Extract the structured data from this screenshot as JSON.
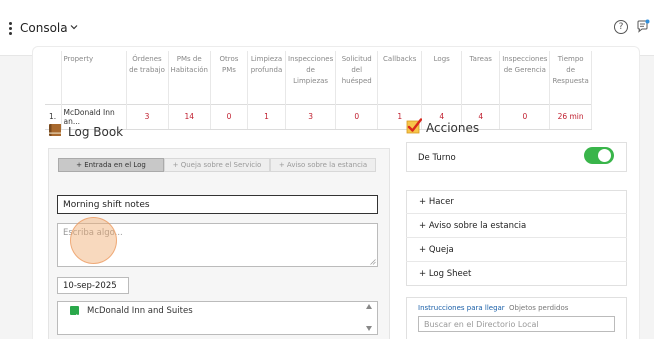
{
  "header": {
    "title": "Consola",
    "icons": {
      "menu": "vertical-dots-icon",
      "chevron": "chevron-down-icon",
      "help": "help-circle-icon",
      "chat": "chat-notification-icon"
    }
  },
  "stats_table": {
    "columns": [
      "",
      "Property",
      "Órdenes de trabajo",
      "PMs de Habitación",
      "Otros PMs",
      "Limpieza profunda",
      "Inspecciones de Limpiezas",
      "Solicitud del huésped",
      "Callbacks",
      "Logs",
      "Tareas",
      "Inspecciones de Gerencia",
      "Tiempo de Respuesta"
    ],
    "rows": [
      {
        "index": "1.",
        "property": "McDonald Inn an...",
        "values": [
          "3",
          "14",
          "0",
          "1",
          "3",
          "0",
          "1",
          "4",
          "4",
          "0",
          "26 min"
        ]
      }
    ]
  },
  "log_book": {
    "title": "Log Book",
    "tabs": [
      "+ Entrada en el Log",
      "+ Queja sobre el Servicio",
      "+ Aviso sobre la estancia"
    ],
    "active_tab": 0,
    "subject_value": "Morning shift notes",
    "body_placeholder": "Escriba algo...",
    "date_value": "10-sep-2025",
    "properties": [
      {
        "label": "McDonald Inn and Suites",
        "checked": true
      }
    ]
  },
  "actions": {
    "title": "Acciones",
    "shift_label": "De Turno",
    "shift_on": true,
    "items": [
      "+ Hacer",
      "+ Aviso sobre la estancia",
      "+ Queja",
      "+ Log Sheet"
    ],
    "info_tabs": [
      "Instrucciones para llegar",
      "Objetos perdidos"
    ],
    "directory_placeholder": "Buscar en el Directorio Local"
  },
  "colors": {
    "accent_green": "#39b54a",
    "value_red": "#c02030",
    "link_blue": "#1a5fa8"
  }
}
